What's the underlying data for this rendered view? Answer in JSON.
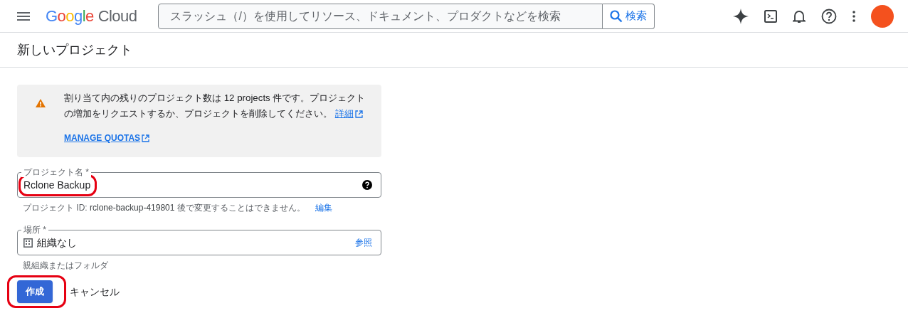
{
  "header": {
    "logo": {
      "brand": "Google",
      "product": "Cloud"
    },
    "search": {
      "placeholder": "スラッシュ（/）を使用してリソース、ドキュメント、プロダクトなどを検索",
      "button": "検索"
    }
  },
  "page_title": "新しいプロジェクト",
  "notice": {
    "text": "割り当て内の残りのプロジェクト数は 12 projects 件です。プロジェクトの増加をリクエストするか、プロジェクトを削除してください。",
    "link": "詳細",
    "action": "MANAGE QUOTAS"
  },
  "project_name": {
    "label": "プロジェクト名 *",
    "value": "Rclone Backup",
    "highlighted": true,
    "hint": "プロジェクト ID: **rclone-backup-419801** 後で変更することはできません。",
    "hint_link": "編集"
  },
  "location": {
    "label": "場所 *",
    "value": "組織なし",
    "browse": "参照",
    "hint": "親組織またはフォルダ"
  },
  "buttons": [
    {
      "label": "作成",
      "kind": "primary",
      "highlighted": true
    },
    {
      "label": "キャンセル",
      "kind": "text",
      "highlighted": false
    }
  ]
}
